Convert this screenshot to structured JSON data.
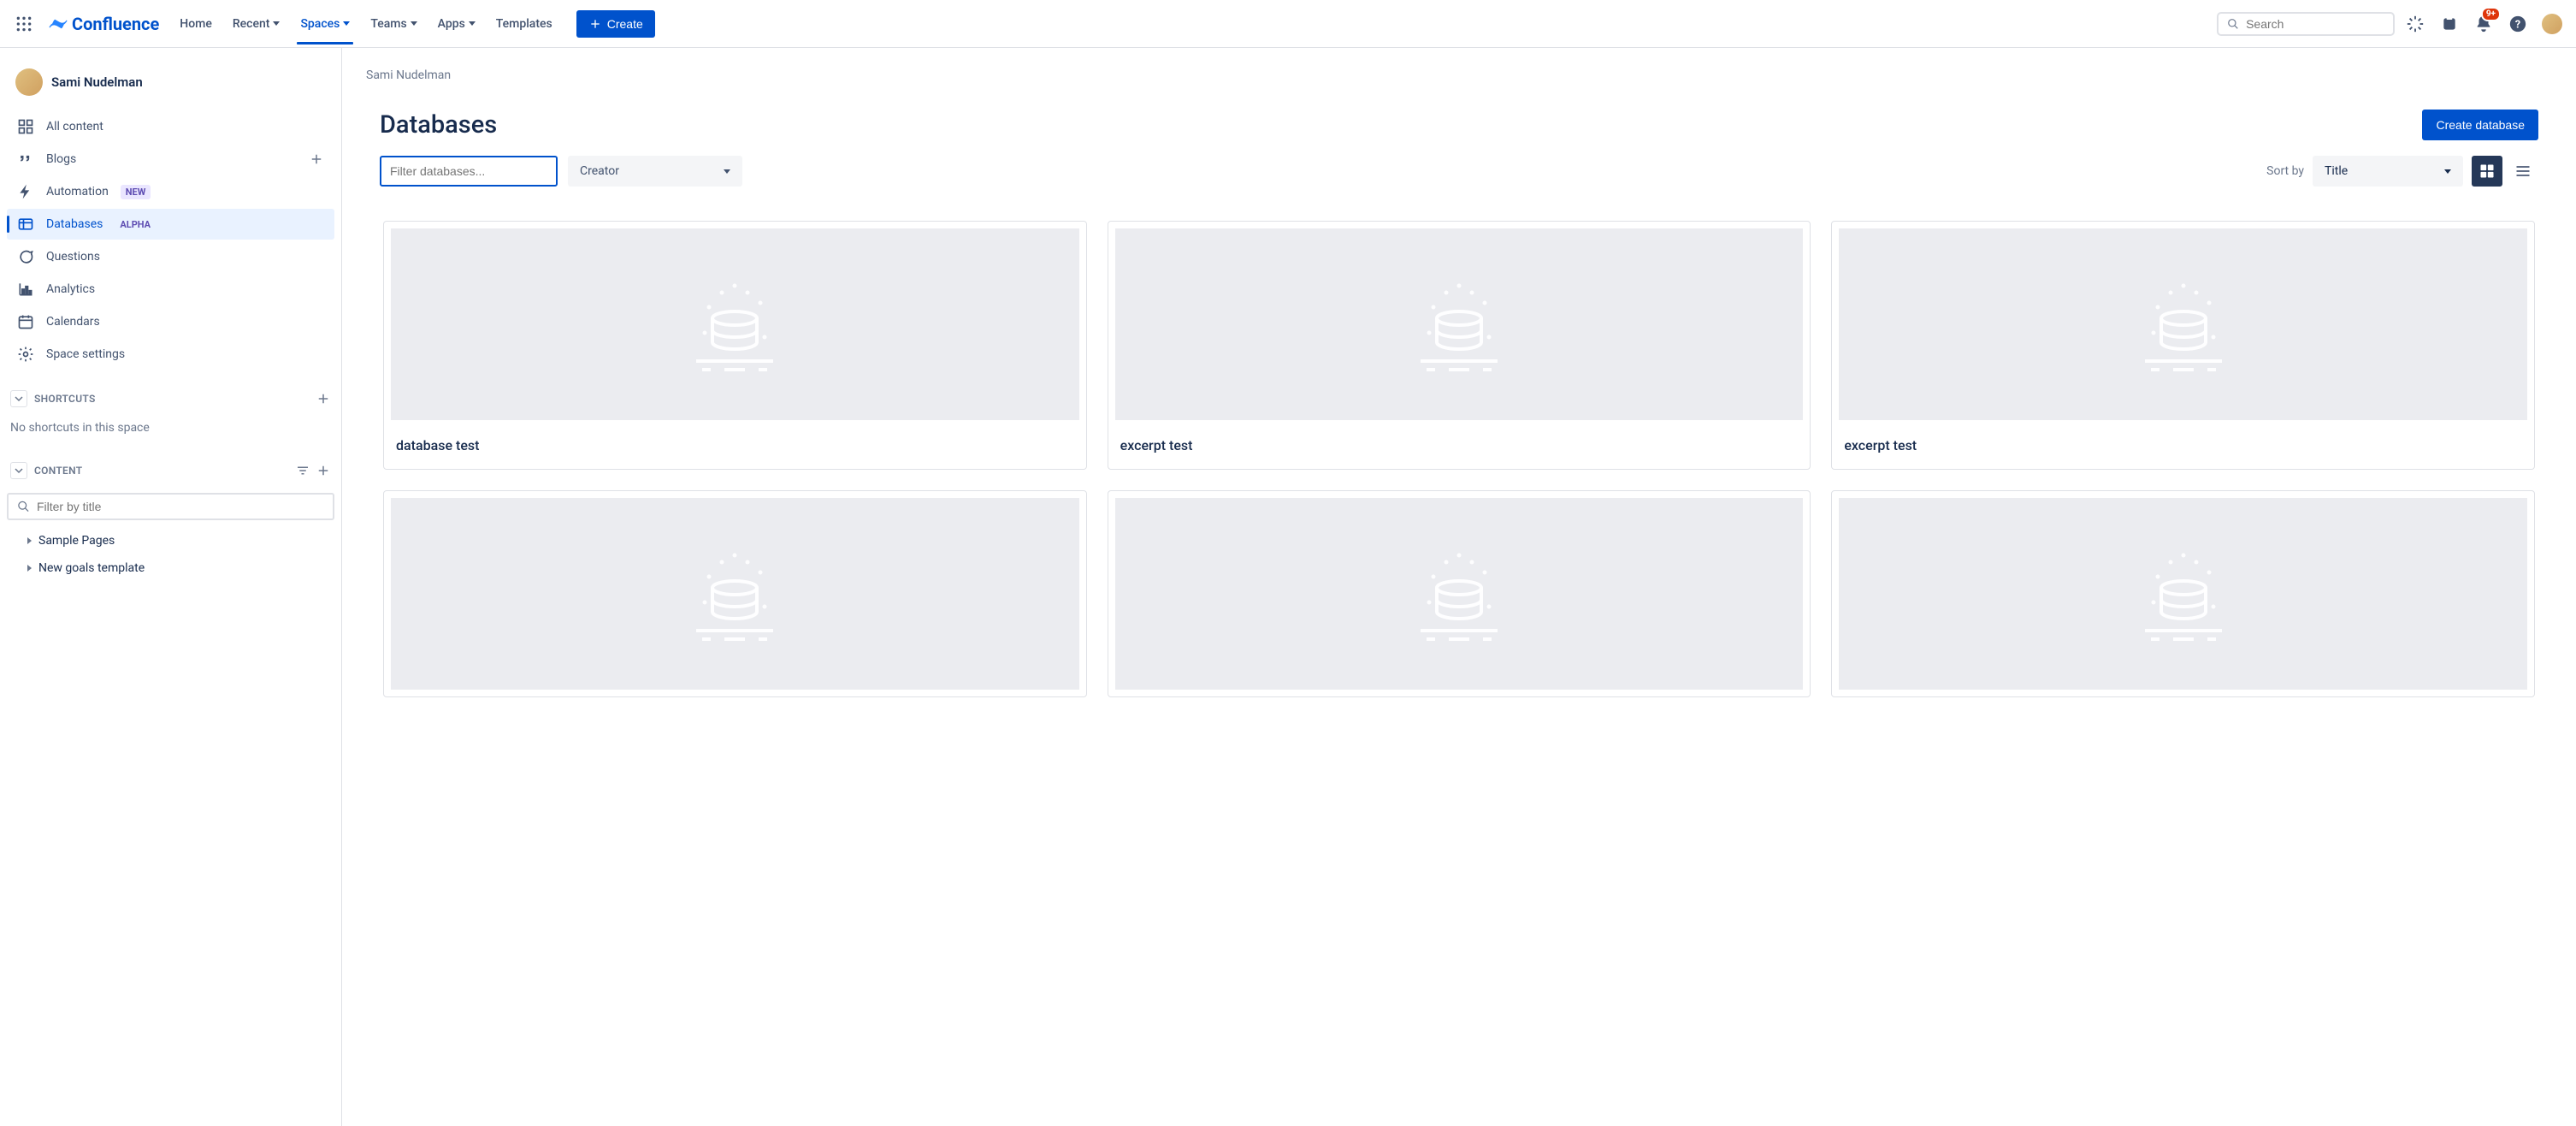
{
  "topnav": {
    "product": "Confluence",
    "items": [
      "Home",
      "Recent",
      "Spaces",
      "Teams",
      "Apps",
      "Templates"
    ],
    "active_index": 2,
    "has_dropdown": [
      false,
      true,
      true,
      true,
      true,
      false
    ],
    "create_label": "Create",
    "search_placeholder": "Search",
    "notification_badge": "9+"
  },
  "sidebar": {
    "space_name": "Sami Nudelman",
    "items": [
      {
        "label": "All content",
        "icon": "grid-icon",
        "pill": null
      },
      {
        "label": "Blogs",
        "icon": "quote-icon",
        "pill": null,
        "add": true
      },
      {
        "label": "Automation",
        "icon": "bolt-icon",
        "pill": "NEW",
        "pill_class": "new"
      },
      {
        "label": "Databases",
        "icon": "table-icon",
        "pill": "ALPHA",
        "pill_class": "alpha",
        "active": true
      },
      {
        "label": "Questions",
        "icon": "chat-icon",
        "pill": null
      },
      {
        "label": "Analytics",
        "icon": "chart-icon",
        "pill": null
      },
      {
        "label": "Calendars",
        "icon": "calendar-icon",
        "pill": null
      },
      {
        "label": "Space settings",
        "icon": "gear-icon",
        "pill": null
      }
    ],
    "shortcuts_heading": "SHORTCUTS",
    "shortcuts_empty": "No shortcuts in this space",
    "content_heading": "CONTENT",
    "content_filter_placeholder": "Filter by title",
    "tree": [
      "Sample Pages",
      "New goals template"
    ]
  },
  "main": {
    "breadcrumb": "Sami Nudelman",
    "title": "Databases",
    "create_button": "Create database",
    "filter_placeholder": "Filter databases...",
    "creator_label": "Creator",
    "sort_label": "Sort by",
    "sort_value": "Title",
    "cards": [
      {
        "title": "database test"
      },
      {
        "title": "excerpt test"
      },
      {
        "title": "excerpt test"
      },
      {
        "title": ""
      },
      {
        "title": ""
      },
      {
        "title": ""
      }
    ]
  }
}
